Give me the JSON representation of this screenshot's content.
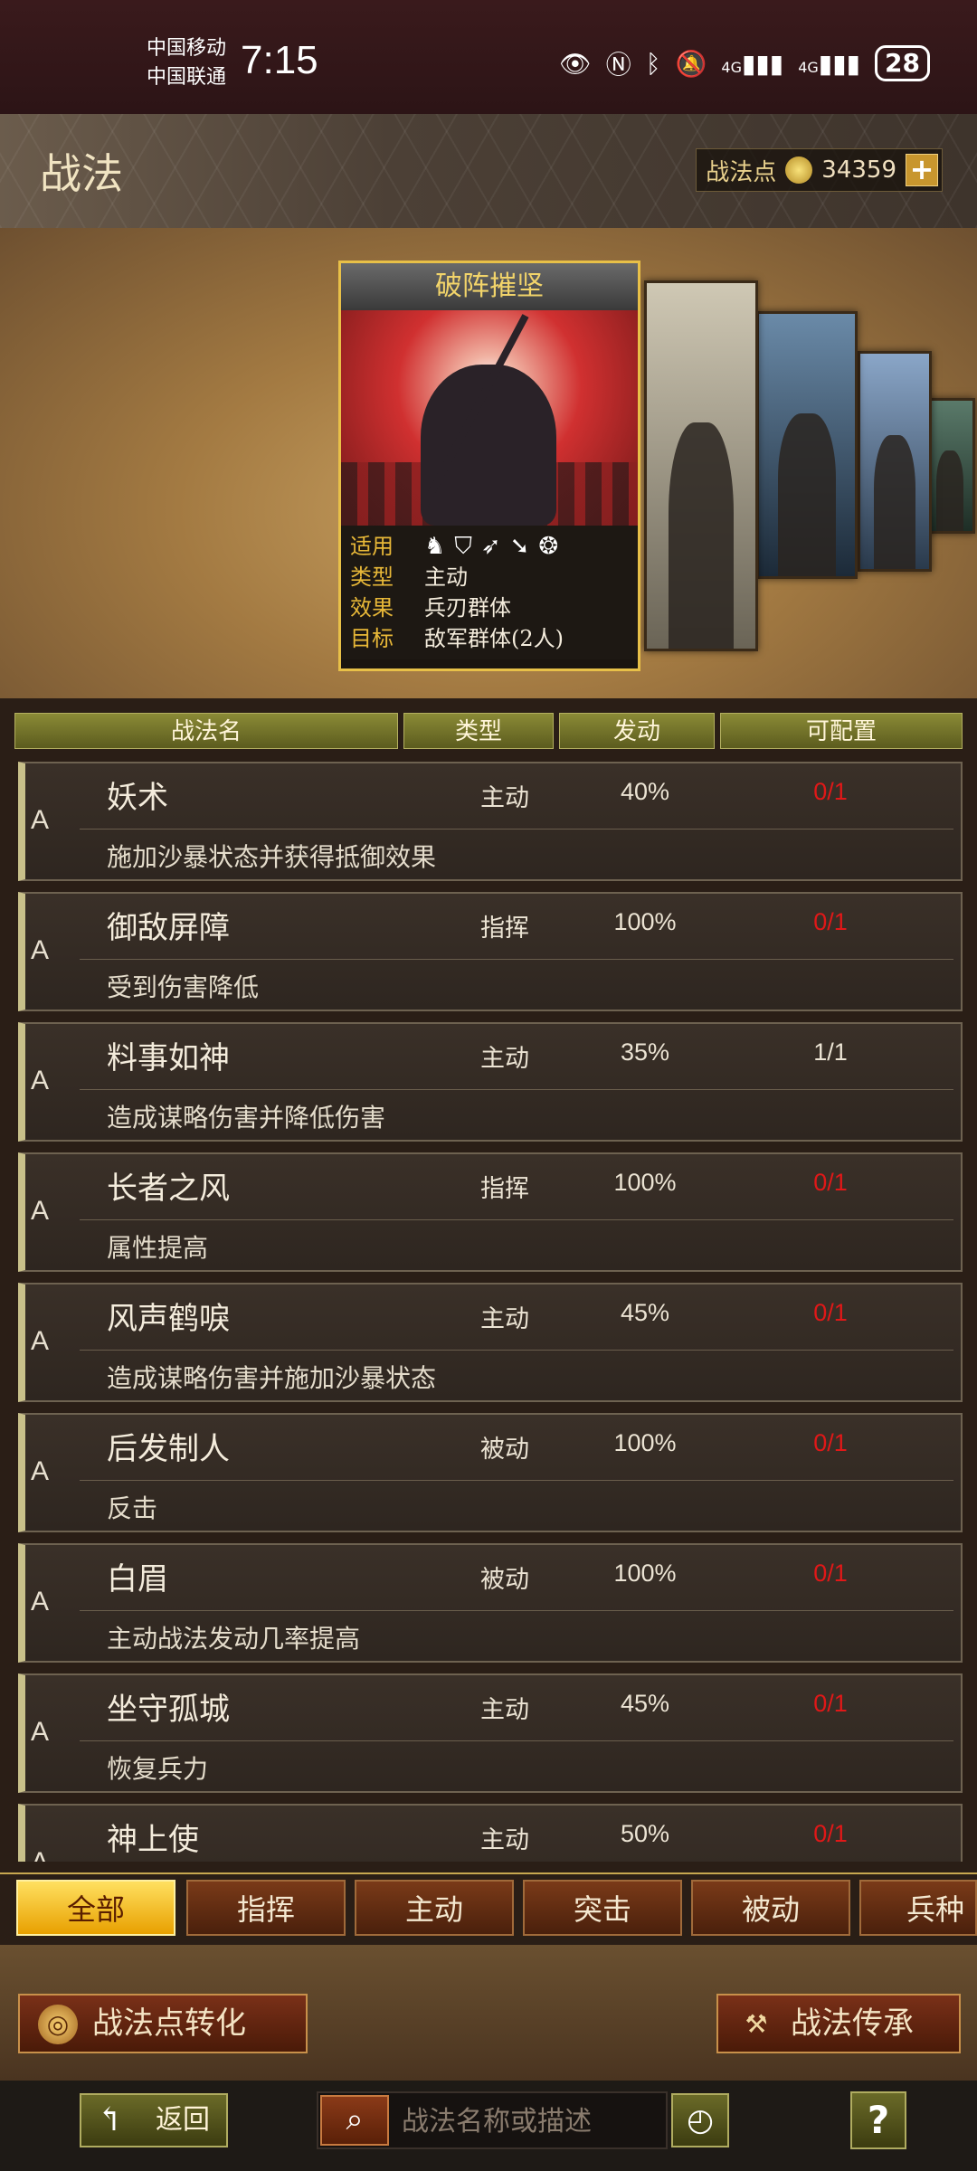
{
  "status_bar": {
    "carrier1": "中国移动",
    "carrier2": "中国联通",
    "time": "7:15",
    "icons": [
      "eye-icon",
      "nfc-icon",
      "bluetooth-icon",
      "mute-icon",
      "signal-4g-icon",
      "signal-4g-icon"
    ],
    "signal1": "4G",
    "signal2": "4G",
    "battery": "28"
  },
  "header": {
    "title": "战法",
    "points_label": "战法点",
    "points_value": "34359",
    "plus_label": "+"
  },
  "featured_card": {
    "title": "破阵摧坚",
    "rows": [
      {
        "key": "适用",
        "value": ""
      },
      {
        "key": "类型",
        "value": "主动"
      },
      {
        "key": "效果",
        "value": "兵刃群体"
      },
      {
        "key": "目标",
        "value": "敌军群体(2人)"
      }
    ],
    "troop_icons": [
      "cavalry-icon",
      "shield-icon",
      "bow-icon",
      "spear-icon",
      "wheel-icon"
    ]
  },
  "table": {
    "headers": [
      "战法名",
      "类型",
      "发动",
      "可配置"
    ],
    "rows": [
      {
        "grade": "A",
        "name": "妖术",
        "type": "主动",
        "rate": "40%",
        "config": "0/1",
        "config_color": "red",
        "desc": "施加沙暴状态并获得抵御效果"
      },
      {
        "grade": "A",
        "name": "御敌屏障",
        "type": "指挥",
        "rate": "100%",
        "config": "0/1",
        "config_color": "red",
        "desc": "受到伤害降低"
      },
      {
        "grade": "A",
        "name": "料事如神",
        "type": "主动",
        "rate": "35%",
        "config": "1/1",
        "config_color": "white",
        "desc": "造成谋略伤害并降低伤害"
      },
      {
        "grade": "A",
        "name": "长者之风",
        "type": "指挥",
        "rate": "100%",
        "config": "0/1",
        "config_color": "red",
        "desc": "属性提高"
      },
      {
        "grade": "A",
        "name": "风声鹤唳",
        "type": "主动",
        "rate": "45%",
        "config": "0/1",
        "config_color": "red",
        "desc": "造成谋略伤害并施加沙暴状态"
      },
      {
        "grade": "A",
        "name": "后发制人",
        "type": "被动",
        "rate": "100%",
        "config": "0/1",
        "config_color": "red",
        "desc": "反击"
      },
      {
        "grade": "A",
        "name": "白眉",
        "type": "被动",
        "rate": "100%",
        "config": "0/1",
        "config_color": "red",
        "desc": "主动战法发动几率提高"
      },
      {
        "grade": "A",
        "name": "坐守孤城",
        "type": "主动",
        "rate": "45%",
        "config": "0/1",
        "config_color": "red",
        "desc": "恢复兵力"
      },
      {
        "grade": "A",
        "name": "神上使",
        "type": "主动",
        "rate": "50%",
        "config": "0/1",
        "config_color": "red",
        "desc": ""
      }
    ]
  },
  "tabs": [
    {
      "label": "全部",
      "active": true
    },
    {
      "label": "指挥",
      "active": false
    },
    {
      "label": "主动",
      "active": false
    },
    {
      "label": "突击",
      "active": false
    },
    {
      "label": "被动",
      "active": false
    },
    {
      "label": "兵种",
      "active": false
    }
  ],
  "actions": {
    "convert_label": "战法点转化",
    "inherit_label": "战法传承"
  },
  "bottom_bar": {
    "back_label": "返回",
    "search_placeholder": "战法名称或描述",
    "help_label": "?"
  },
  "colors": {
    "config_red": "#e01818",
    "tab_active": "#f0b820",
    "card_border": "#e8c048"
  }
}
